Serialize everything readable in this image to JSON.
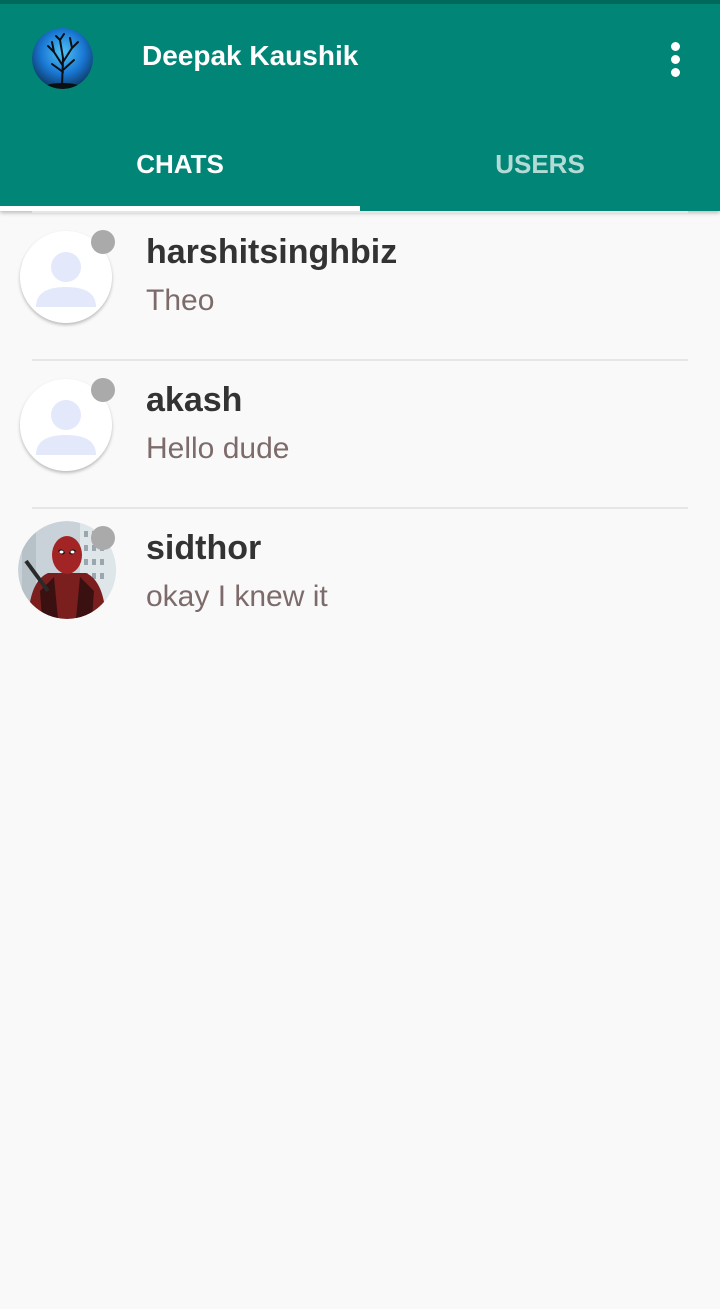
{
  "header": {
    "user_name": "Deepak Kaushik",
    "profile_icon": "tree-profile-avatar-icon",
    "menu_icon": "more-vert-icon",
    "colors": {
      "primary": "#008577",
      "status_bar": "#00695c",
      "indicator": "#ffffff"
    }
  },
  "tabs": [
    {
      "label": "CHATS",
      "selected": true
    },
    {
      "label": "USERS",
      "selected": false
    }
  ],
  "chats": [
    {
      "name": "harshitsinghbiz",
      "message": "Theo",
      "avatar": "default-user-icon",
      "status_color": "#aaaaaa"
    },
    {
      "name": "akash",
      "message": "Hello dude",
      "avatar": "default-user-icon",
      "status_color": "#aaaaaa"
    },
    {
      "name": "sidthor",
      "message": "okay I knew it",
      "avatar": "photo-avatar",
      "status_color": "#aaaaaa"
    }
  ]
}
